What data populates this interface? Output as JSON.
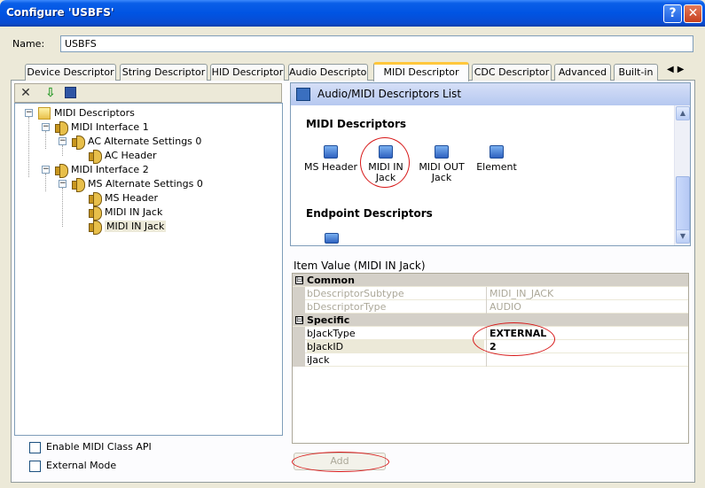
{
  "window": {
    "title": "Configure 'USBFS'",
    "help_label": "?",
    "close_label": "✕"
  },
  "name_field": {
    "label": "Name:",
    "value": "USBFS"
  },
  "tabs": [
    {
      "label": "Device Descriptor"
    },
    {
      "label": "String Descriptor"
    },
    {
      "label": "HID Descriptor"
    },
    {
      "label": "Audio Descriptor"
    },
    {
      "label": "MIDI Descriptor",
      "active": true
    },
    {
      "label": "CDC Descriptor"
    },
    {
      "label": "Advanced"
    },
    {
      "label": "Built-in"
    }
  ],
  "tab_scroll": "◀▶",
  "left_toolbar": {
    "icons": [
      "delete-icon",
      "import-icon",
      "save-icon"
    ],
    "delete_glyph": "✕",
    "import_glyph": "⇩",
    "save_glyph": "▪"
  },
  "tree": {
    "expander_minus": "−",
    "nodes": [
      {
        "label": "MIDI Descriptors",
        "icon": "folder-icon",
        "level": 0
      },
      {
        "label": "MIDI Interface 1",
        "icon": "speaker-icon",
        "level": 1
      },
      {
        "label": "AC Alternate Settings 0",
        "icon": "speaker-icon",
        "level": 2
      },
      {
        "label": "AC Header",
        "icon": "speaker-icon",
        "level": 3
      },
      {
        "label": "MIDI Interface 2",
        "icon": "speaker-icon",
        "level": 1
      },
      {
        "label": "MS Alternate Settings 0",
        "icon": "speaker-icon",
        "level": 2
      },
      {
        "label": "MS Header",
        "icon": "speaker-icon",
        "level": 3
      },
      {
        "label": "MIDI IN Jack",
        "icon": "speaker-icon",
        "level": 3
      },
      {
        "label": "MIDI IN Jack",
        "icon": "speaker-icon",
        "level": 3,
        "selected": true
      }
    ]
  },
  "checkboxes": {
    "enable_midi_class_api": {
      "label": "Enable MIDI Class API",
      "checked": false
    },
    "external_mode": {
      "label": "External Mode",
      "checked": false
    }
  },
  "descriptors_list": {
    "header": "Audio/MIDI Descriptors List",
    "midi_section": "MIDI Descriptors",
    "items": [
      {
        "label": "MS Header"
      },
      {
        "label": "MIDI IN Jack"
      },
      {
        "label": "MIDI OUT Jack"
      },
      {
        "label": "Element"
      }
    ],
    "endpoint_section": "Endpoint Descriptors",
    "scroll_up": "▲",
    "scroll_down": "▼"
  },
  "item_value": {
    "title": "Item Value (MIDI IN Jack)",
    "collapse_glyph": "⊟",
    "categories": [
      {
        "name": "Common",
        "rows": [
          {
            "name": "bDescriptorSubtype",
            "value": "MIDI_IN_JACK",
            "disabled": true
          },
          {
            "name": "bDescriptorType",
            "value": "AUDIO",
            "disabled": true
          }
        ]
      },
      {
        "name": "Specific",
        "rows": [
          {
            "name": "bJackType",
            "value": "EXTERNAL",
            "bold": true
          },
          {
            "name": "bJackID",
            "value": "2",
            "bold": true,
            "selected": true
          },
          {
            "name": "iJack",
            "value": ""
          }
        ]
      }
    ]
  },
  "add_button": {
    "label": "Add",
    "enabled": false
  },
  "colors": {
    "title_bar": "#0054e3",
    "window_bg": "#ece9d8",
    "active_tab_accent": "#ffc73c",
    "annotation_circle": "#d71818"
  }
}
